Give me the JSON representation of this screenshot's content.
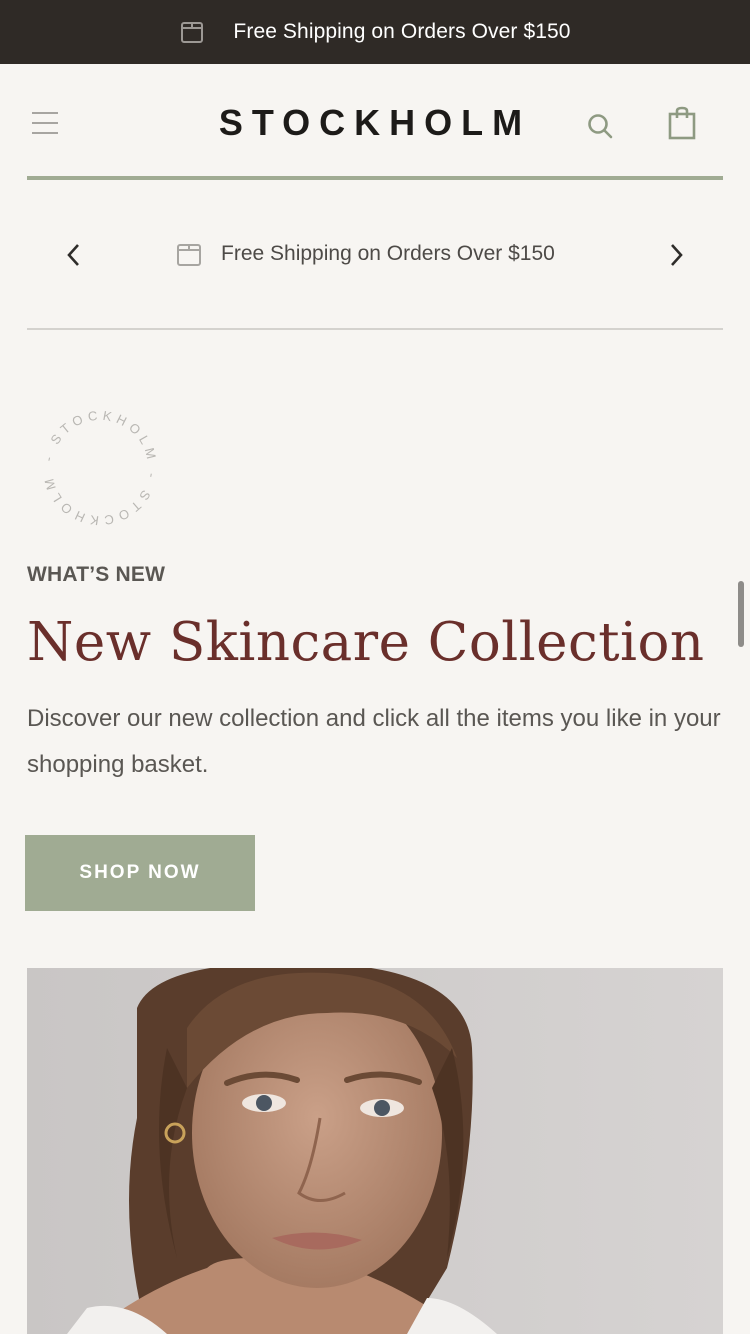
{
  "top_banner": {
    "text": "Free Shipping on Orders Over $150",
    "icon": "box-icon"
  },
  "header": {
    "logo": "STOCKHOLM",
    "menu_icon": "hamburger-menu-icon",
    "search_icon": "search-icon",
    "cart_icon": "shopping-bag-icon"
  },
  "announcement": {
    "text": "Free Shipping on Orders Over $150",
    "icon": "box-icon",
    "prev_icon": "chevron-left-icon",
    "next_icon": "chevron-right-icon"
  },
  "stamp": {
    "text": "- STOCKHOLM - STOCKHOLM"
  },
  "promo": {
    "eyebrow": "WHAT’S NEW",
    "title": "New Skincare Collection",
    "description": "Discover our new collection and click all the items you like in your shopping basket.",
    "cta_label": "SHOP NOW"
  },
  "colors": {
    "top_banner_bg": "#2f2a26",
    "accent_green": "#a0ab93",
    "headline": "#6a2f2b",
    "background": "#f7f5f2"
  }
}
